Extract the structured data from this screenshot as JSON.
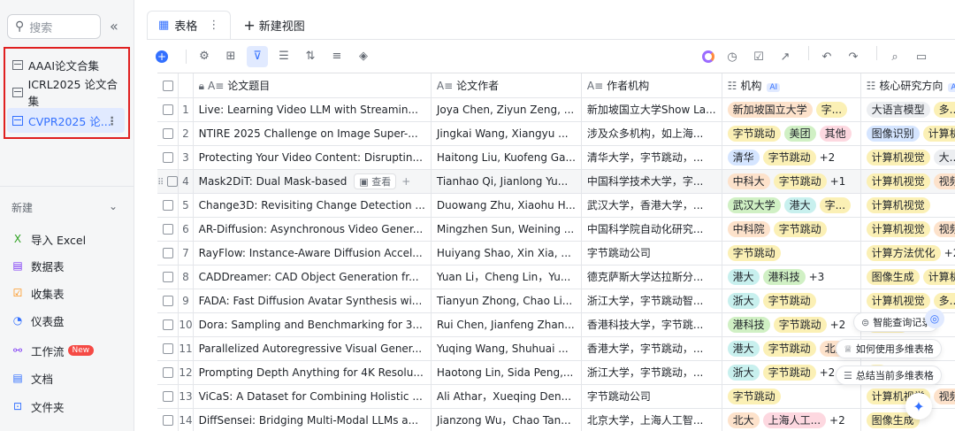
{
  "sidebar": {
    "search_placeholder": "搜索",
    "collapse_icon": "«",
    "tables": [
      {
        "label": "AAAI论文合集"
      },
      {
        "label": "ICRL2025 论文合集"
      },
      {
        "label": "CVPR2025 论..."
      }
    ],
    "new_label": "新建",
    "menu": [
      {
        "icon": "excel-icon",
        "glyph": "X",
        "color": "#2ea121",
        "label": "导入 Excel"
      },
      {
        "icon": "datatable-icon",
        "glyph": "▤",
        "color": "#7f3bf5",
        "label": "数据表"
      },
      {
        "icon": "form-icon",
        "glyph": "☑",
        "color": "#ff8800",
        "label": "收集表"
      },
      {
        "icon": "dashboard-icon",
        "glyph": "◔",
        "color": "#3370ff",
        "label": "仪表盘"
      },
      {
        "icon": "workflow-icon",
        "glyph": "⚯",
        "color": "#7f3bf5",
        "label": "工作流",
        "badge": "New"
      },
      {
        "icon": "doc-icon",
        "glyph": "▤",
        "color": "#3370ff",
        "label": "文档"
      },
      {
        "icon": "folder-icon",
        "glyph": "⊡",
        "color": "#3370ff",
        "label": "文件夹"
      }
    ]
  },
  "tabs": {
    "table_tab": "表格",
    "new_view": "新建视图"
  },
  "columns": [
    "论文题目",
    "论文作者",
    "作者机构",
    "机构",
    "核心研究方向"
  ],
  "ai_badge": "AI",
  "expand_label": "查看",
  "rows": [
    {
      "n": "1",
      "title": "Live: Learning Video LLM with Streamin...",
      "authors": "Joya Chen, Ziyun Zeng, ...",
      "inst": "新加坡国立大学Show La...",
      "orgs": [
        [
          "新加坡国立大学",
          "t-orange"
        ],
        [
          "字...",
          "t-yellow"
        ]
      ],
      "orgs_more": "",
      "dirs": [
        [
          "大语言模型",
          "t-gray"
        ],
        [
          "多...",
          "t-yellow"
        ]
      ],
      "dirs_more": "+1"
    },
    {
      "n": "2",
      "title": "NTIRE 2025 Challenge on Image Super-...",
      "authors": "Jingkai Wang, Xiangyu ...",
      "inst": "涉及众多机构，如上海...",
      "orgs": [
        [
          "字节跳动",
          "t-yellow"
        ],
        [
          "美团",
          "t-green"
        ],
        [
          "其他",
          "t-pink"
        ]
      ],
      "orgs_more": "",
      "dirs": [
        [
          "图像识别",
          "t-blue"
        ],
        [
          "计算机视觉",
          "t-yellow"
        ]
      ],
      "dirs_more": ""
    },
    {
      "n": "3",
      "title": "Protecting Your Video Content: Disruptin...",
      "authors": "Haitong Liu, Kuofeng Ga...",
      "inst": "清华大学，字节跳动，...",
      "orgs": [
        [
          "清华",
          "t-blue"
        ],
        [
          "字节跳动",
          "t-yellow"
        ]
      ],
      "orgs_more": "+2",
      "dirs": [
        [
          "计算机视觉",
          "t-yellow"
        ],
        [
          "大...",
          "t-gray"
        ]
      ],
      "dirs_more": "+1"
    },
    {
      "n": "4",
      "title": "Mask2DiT: Dual Mask-based",
      "authors": "Tianhao Qi, Jianlong Yu...",
      "inst": "中国科学技术大学，字...",
      "orgs": [
        [
          "中科大",
          "t-orange"
        ],
        [
          "字节跳动",
          "t-yellow"
        ]
      ],
      "orgs_more": "+1",
      "dirs": [
        [
          "计算机视觉",
          "t-yellow"
        ],
        [
          "视频生成",
          "t-orange"
        ]
      ],
      "dirs_more": ""
    },
    {
      "n": "5",
      "title": "Change3D: Revisiting Change Detection ...",
      "authors": "Duowang Zhu, Xiaohu H...",
      "inst": "武汉大学，香港大学，...",
      "orgs": [
        [
          "武汉大学",
          "t-green"
        ],
        [
          "港大",
          "t-cyan"
        ],
        [
          "字...",
          "t-yellow"
        ]
      ],
      "orgs_more": "",
      "dirs": [
        [
          "计算机视觉",
          "t-yellow"
        ]
      ],
      "dirs_more": ""
    },
    {
      "n": "6",
      "title": "AR-Diffusion: Asynchronous Video Gener...",
      "authors": "Mingzhen Sun, Weining ...",
      "inst": "中国科学院自动化研究...",
      "orgs": [
        [
          "中科院",
          "t-orange"
        ],
        [
          "字节跳动",
          "t-yellow"
        ]
      ],
      "orgs_more": "",
      "dirs": [
        [
          "计算机视觉",
          "t-yellow"
        ],
        [
          "视频生成",
          "t-orange"
        ]
      ],
      "dirs_more": ""
    },
    {
      "n": "7",
      "title": "RayFlow: Instance-Aware Diffusion Accel...",
      "authors": "Huiyang Shao, Xin Xia, ...",
      "inst": "字节跳动公司",
      "orgs": [
        [
          "字节跳动",
          "t-yellow"
        ]
      ],
      "orgs_more": "",
      "dirs": [
        [
          "计算方法优化",
          "t-yellow"
        ]
      ],
      "dirs_more": "+2"
    },
    {
      "n": "8",
      "title": "CADDreamer: CAD Object Generation fr...",
      "authors": "Yuan Li，Cheng Lin，Yu...",
      "inst": "德克萨斯大学达拉斯分...",
      "orgs": [
        [
          "港大",
          "t-cyan"
        ],
        [
          "港科技",
          "t-green"
        ]
      ],
      "orgs_more": "+3",
      "dirs": [
        [
          "图像生成",
          "t-yellow"
        ],
        [
          "计算机视觉",
          "t-yellow"
        ]
      ],
      "dirs_more": ""
    },
    {
      "n": "9",
      "title": "FADA: Fast Diffusion Avatar Synthesis wi...",
      "authors": "Tianyun Zhong, Chao Li...",
      "inst": "浙江大学，字节跳动智...",
      "orgs": [
        [
          "浙大",
          "t-cyan"
        ],
        [
          "字节跳动",
          "t-yellow"
        ]
      ],
      "orgs_more": "",
      "dirs": [
        [
          "计算机视觉",
          "t-yellow"
        ],
        [
          "多...",
          "t-yellow"
        ]
      ],
      "dirs_more": "+1"
    },
    {
      "n": "10",
      "title": "Dora: Sampling and Benchmarking for 3...",
      "authors": "Rui Chen, Jianfeng Zhan...",
      "inst": "香港科技大学，字节跳...",
      "orgs": [
        [
          "港科技",
          "t-green"
        ],
        [
          "字节跳动",
          "t-yellow"
        ]
      ],
      "orgs_more": "+2",
      "dirs": [
        [
          "计算机",
          "t-yellow"
        ]
      ],
      "dirs_more": ""
    },
    {
      "n": "11",
      "title": "Parallelized Autoregressive Visual Gener...",
      "authors": "Yuqing Wang, Shuhuai ...",
      "inst": "香港大学，字节跳动，...",
      "orgs": [
        [
          "港大",
          "t-cyan"
        ],
        [
          "字节跳动",
          "t-yellow"
        ],
        [
          "北大",
          "t-orange"
        ]
      ],
      "orgs_more": "",
      "dirs": [
        [
          "计",
          "t-yellow"
        ]
      ],
      "dirs_more": "1"
    },
    {
      "n": "12",
      "title": "Prompting Depth Anything for 4K Resolu...",
      "authors": "Haotong Lin, Sida Peng,...",
      "inst": "浙江大学，字节跳动，...",
      "orgs": [
        [
          "浙大",
          "t-cyan"
        ],
        [
          "字节跳动",
          "t-yellow"
        ]
      ],
      "orgs_more": "+2",
      "dirs": [
        [
          "计",
          "t-yellow"
        ]
      ],
      "dirs_more": ""
    },
    {
      "n": "13",
      "title": "ViCaS: A Dataset for Combining Holistic ...",
      "authors": "Ali Athar，Xueqing Den...",
      "inst": "字节跳动公司",
      "orgs": [
        [
          "字节跳动",
          "t-yellow"
        ]
      ],
      "orgs_more": "",
      "dirs": [
        [
          "计算机视觉",
          "t-yellow"
        ],
        [
          "视频生成",
          "t-orange"
        ]
      ],
      "dirs_more": ""
    },
    {
      "n": "14",
      "title": "DiffSensei: Bridging Multi-Modal LLMs a...",
      "authors": "Jianzong Wu，Chao Tan...",
      "inst": "北京大学，上海人工智...",
      "orgs": [
        [
          "北大",
          "t-orange"
        ],
        [
          "上海人工...",
          "t-pink"
        ]
      ],
      "orgs_more": "+2",
      "dirs": [
        [
          "图像生成",
          "t-yellow"
        ]
      ],
      "dirs_more": ""
    }
  ],
  "floats": {
    "smart_query": "智能查询记录",
    "how_to_use": "如何使用多维表格",
    "summarize": "总结当前多维表格"
  }
}
